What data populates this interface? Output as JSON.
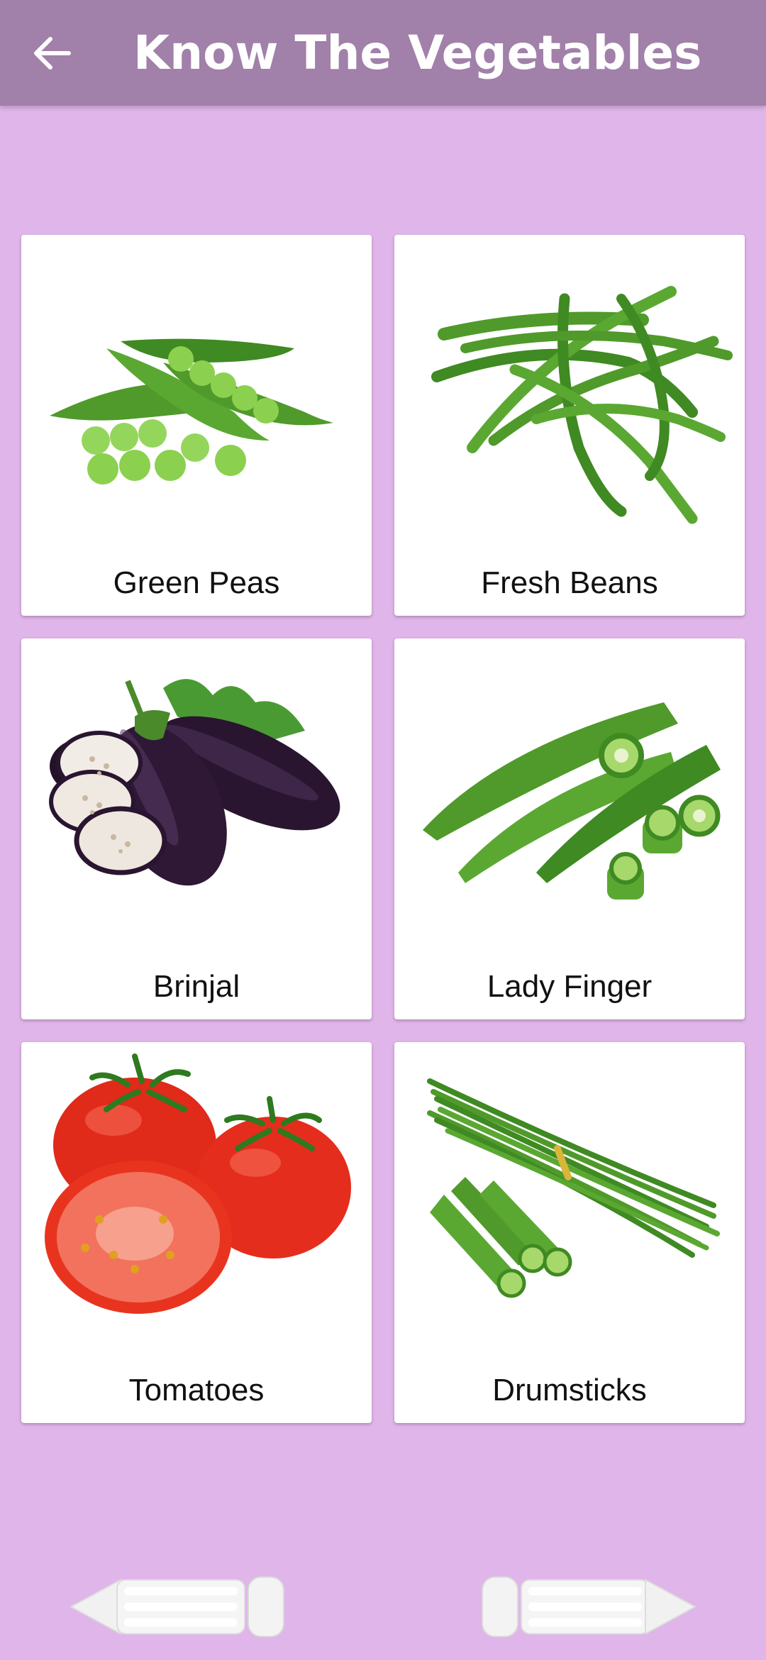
{
  "appbar": {
    "title": "Know The Vegetables",
    "back_icon": "arrow-left-icon"
  },
  "cards": [
    {
      "label": "Green Peas",
      "image": "green-peas-image"
    },
    {
      "label": "Fresh Beans",
      "image": "fresh-beans-image"
    },
    {
      "label": "Brinjal",
      "image": "brinjal-image"
    },
    {
      "label": "Lady Finger",
      "image": "lady-finger-image"
    },
    {
      "label": "Tomatoes",
      "image": "tomatoes-image"
    },
    {
      "label": "Drumsticks",
      "image": "drumsticks-image"
    }
  ],
  "nav": {
    "prev_icon": "pencil-arrow-left-icon",
    "next_icon": "pencil-arrow-right-icon"
  },
  "colors": {
    "appbar": "#a180a9",
    "background": "#e0b5e9",
    "card": "#ffffff"
  }
}
